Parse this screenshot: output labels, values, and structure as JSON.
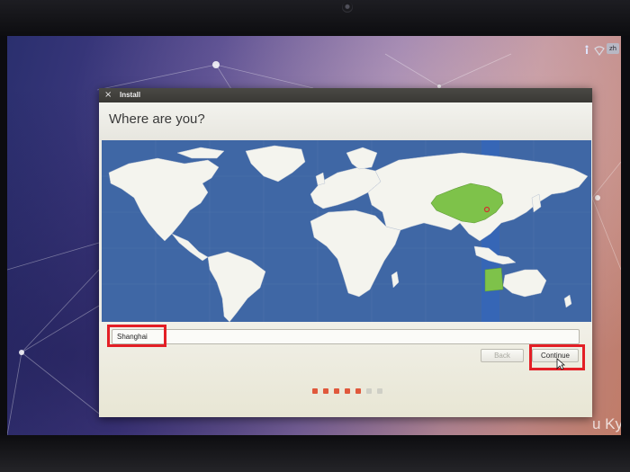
{
  "window": {
    "title": "Install",
    "close_glyph": "×"
  },
  "page": {
    "heading": "Where are you?"
  },
  "location": {
    "value": "Shanghai",
    "selected_region": "China",
    "highlight_color": "#7ec24a",
    "timezone_band_color": "#3566b8"
  },
  "buttons": {
    "back": "Back",
    "continue": "Continue"
  },
  "wallpaper": {
    "brand": "u Kylin"
  },
  "progress": {
    "total_steps": 7,
    "completed_steps": 5,
    "done_color": "#e0583c",
    "todo_color": "#cfcfc6"
  },
  "annotations": {
    "color": "#e31f26",
    "targets": [
      "location-input",
      "continue-button"
    ]
  }
}
